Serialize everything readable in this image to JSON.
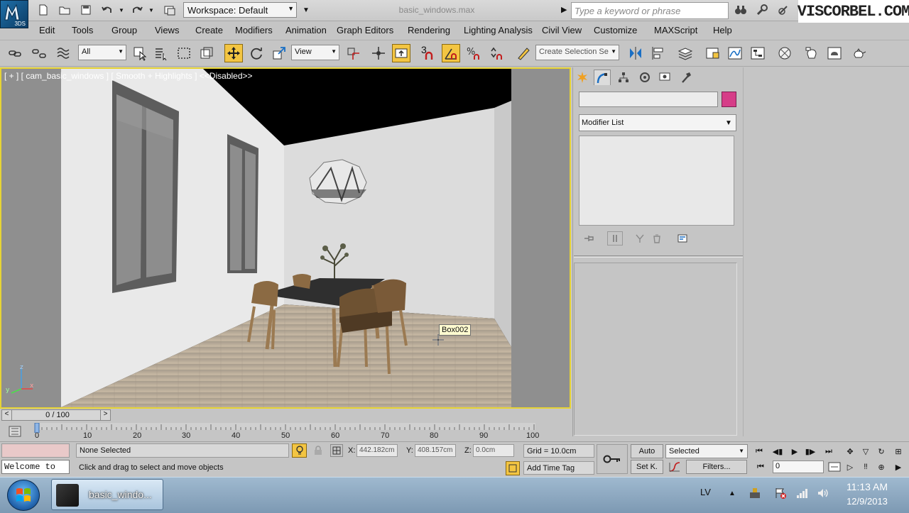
{
  "app": {
    "logo_label": "3DS",
    "file_title": "basic_windows.max",
    "workspace": "Workspace: Default",
    "search_placeholder": "Type a keyword or phrase",
    "watermark": "VISCORBEL.COM"
  },
  "menu": [
    "Edit",
    "Tools",
    "Group",
    "Views",
    "Create",
    "Modifiers",
    "Animation",
    "Graph Editors",
    "Rendering",
    "Lighting Analysis",
    "Civil View",
    "Customize",
    "MAXScript",
    "Help"
  ],
  "toolbar": {
    "filter_value": "All",
    "ref_coord_value": "View",
    "snap_label": "3",
    "selection_set_placeholder": "Create Selection Se"
  },
  "viewport": {
    "label": "[ + ] [ cam_basic_windows ] [ Smooth + Highlights ] <<Disabled>>",
    "tooltip": "Box002",
    "axis_x": "x",
    "axis_y": "y",
    "axis_z": "z"
  },
  "command_panel": {
    "object_color": "#d63d88",
    "modifier_list": "Modifier List"
  },
  "timeline": {
    "slider_text": "0 / 100",
    "prev": "<",
    "next": ">",
    "ticks": [
      "0",
      "10",
      "20",
      "30",
      "40",
      "50",
      "60",
      "70",
      "80",
      "90",
      "100"
    ]
  },
  "status": {
    "welcome": "Welcome to",
    "selection": "None Selected",
    "prompt": "Click and drag to select and move objects",
    "x_label": "X:",
    "x_value": "442.182cm",
    "y_label": "Y:",
    "y_value": "408.157cm",
    "z_label": "Z:",
    "z_value": "0.0cm",
    "grid": "Grid = 10.0cm",
    "add_time_tag": "Add Time Tag",
    "auto": "Auto",
    "set_key": "Set K.",
    "selected_dd": "Selected",
    "filters": "Filters...",
    "frame_value": "0"
  },
  "taskbar": {
    "app_label": "basic_windo...",
    "lang": "LV",
    "time": "11:13 AM",
    "date": "12/9/2013"
  },
  "icons": {
    "new": "new-file-icon",
    "open": "open-folder-icon",
    "save": "save-icon",
    "undo": "undo-icon",
    "redo": "redo-icon",
    "move": "select-move-icon",
    "rotate": "rotate-icon",
    "scale": "scale-icon"
  }
}
